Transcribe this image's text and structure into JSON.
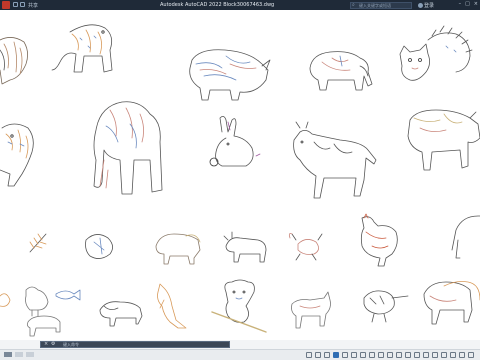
{
  "titlebar": {
    "share_label": "共享",
    "window_title": "Autodesk AutoCAD 2022    Block30067463.dwg",
    "search_placeholder": "键入关键字或短语",
    "user_label": "登录"
  },
  "cmdbar": {
    "placeholder": "键入命令"
  },
  "colors": {
    "titlebar_bg": "#1f2a38",
    "canvas_bg": "#ffffff",
    "statusbar_bg": "#e9ecef",
    "accent_blue": "#2f6db3"
  },
  "canvas": {
    "drawing_count": 33
  }
}
